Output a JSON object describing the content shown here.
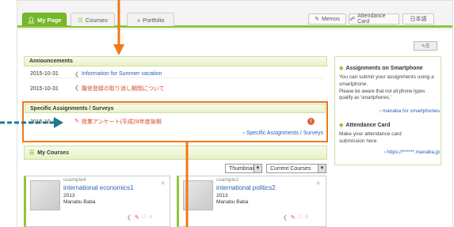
{
  "tabs": [
    {
      "label": "My Page",
      "active": true,
      "icon": "person-icon"
    },
    {
      "label": "Courses",
      "active": false,
      "icon": "courses-icon"
    },
    {
      "label": "Portfolio",
      "active": false,
      "icon": "portfolio-icon"
    }
  ],
  "toolbar": {
    "memos_label": "Memos",
    "attendance_label": "Attendance Card",
    "language_label": "日本語"
  },
  "announcements": {
    "title": "Announcements",
    "items": [
      {
        "date": "2015-10-31",
        "text": "Information for Summer vacation",
        "color": "link"
      },
      {
        "date": "2015-10-31",
        "text": "履修登録の取り消し期間について",
        "color": "red"
      }
    ]
  },
  "assignments": {
    "title": "Specific Assignments / Surveys",
    "items": [
      {
        "date": "2015-10-12",
        "text": "授業アンケート(平成28年度後期"
      }
    ],
    "more_link": "Specific Assignments / Surveys"
  },
  "my_courses": {
    "title": "My Courses",
    "view_select": "Thumbnail",
    "filter_select": "Current Courses",
    "courses": [
      {
        "code": "usample4",
        "name": "international economics1",
        "year": "2013",
        "teacher": "Manabu Baba"
      },
      {
        "code": "usample2",
        "name": "international politics2",
        "year": "2013",
        "teacher": "Manabu Baba"
      }
    ]
  },
  "sidebar": {
    "smartphone_title": "Assignments on Smartphone",
    "smartphone_text1": "You can submit your assignments using a smartphone.",
    "smartphone_text2": "Please be aware that not all phone types qualify as 'smartphones.'",
    "smartphone_link": "manaba for smartphones",
    "attendance_title": "Attendance Card",
    "attendance_text": "Make your attendance card submission here.",
    "attendance_link": "https://******.manaba.jp"
  },
  "colors": {
    "accent_green": "#8fc63d",
    "highlight_orange": "#f07818",
    "annotation_teal": "#1f7a8c",
    "link_blue": "#2a62b7",
    "alert_red": "#d84a22"
  }
}
